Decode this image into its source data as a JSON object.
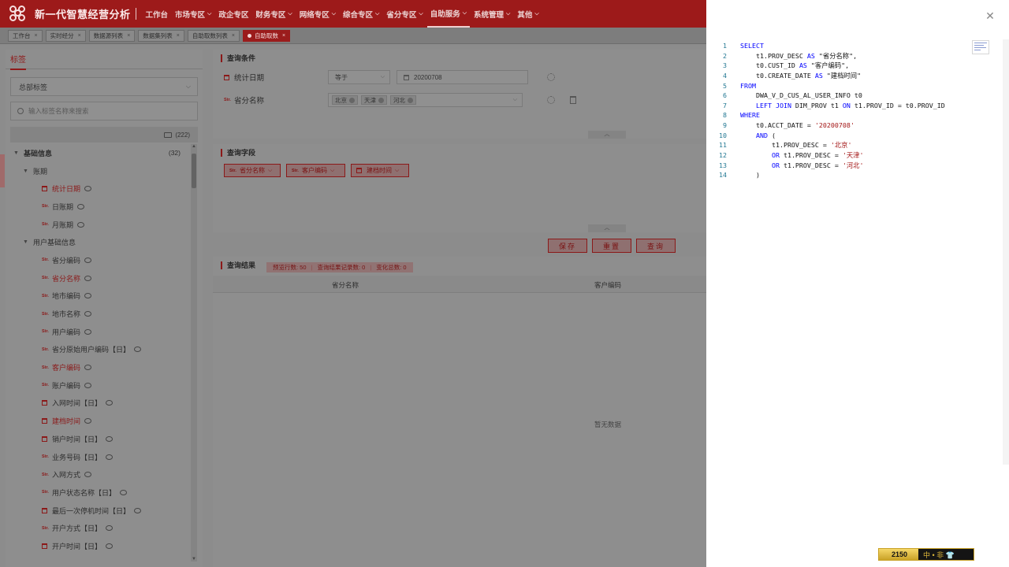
{
  "header": {
    "brand": "新一代智慧经营分析",
    "nav": [
      {
        "label": "工作台",
        "caret": false
      },
      {
        "label": "市场专区",
        "caret": true
      },
      {
        "label": "政企专区",
        "caret": false
      },
      {
        "label": "财务专区",
        "caret": true
      },
      {
        "label": "网络专区",
        "caret": true
      },
      {
        "label": "综合专区",
        "caret": true
      },
      {
        "label": "省分专区",
        "caret": true
      },
      {
        "label": "自助服务",
        "caret": true,
        "active": true
      },
      {
        "label": "系统管理",
        "caret": true
      },
      {
        "label": "其他",
        "caret": true
      }
    ]
  },
  "tabs": [
    {
      "label": "工作台"
    },
    {
      "label": "实时经分"
    },
    {
      "label": "数据源列表"
    },
    {
      "label": "数据集列表"
    },
    {
      "label": "自助取数列表"
    },
    {
      "label": "自助取数",
      "active": true
    }
  ],
  "left_panel": {
    "header": "标签",
    "select_value": "总部标签",
    "search_placeholder": "输入标签名称来搜索",
    "total_count": "(222)",
    "tree": [
      {
        "level": 1,
        "label": "基础信息",
        "count": "(32)"
      },
      {
        "level": 2,
        "label": "账期"
      },
      {
        "level": 3,
        "type": "cal",
        "label": "统计日期",
        "red": true
      },
      {
        "level": 3,
        "type": "Str.",
        "label": "日账期"
      },
      {
        "level": 3,
        "type": "Str.",
        "label": "月账期"
      },
      {
        "level": 2,
        "label": "用户基础信息"
      },
      {
        "level": 3,
        "type": "Str.",
        "label": "省分编码"
      },
      {
        "level": 3,
        "type": "Str.",
        "label": "省分名称",
        "red": true
      },
      {
        "level": 3,
        "type": "Str.",
        "label": "地市编码"
      },
      {
        "level": 3,
        "type": "Str.",
        "label": "地市名称"
      },
      {
        "level": 3,
        "type": "Str.",
        "label": "用户编码"
      },
      {
        "level": 3,
        "type": "Str.",
        "label": "省分原始用户编码【日】"
      },
      {
        "level": 3,
        "type": "Str.",
        "label": "客户编码",
        "red": true
      },
      {
        "level": 3,
        "type": "Str.",
        "label": "账户编码"
      },
      {
        "level": 3,
        "type": "cal",
        "label": "入网时间【日】"
      },
      {
        "level": 3,
        "type": "cal",
        "label": "建档时间",
        "red": true
      },
      {
        "level": 3,
        "type": "cal",
        "label": "销户时间【日】"
      },
      {
        "level": 3,
        "type": "Str.",
        "label": "业务号码【日】"
      },
      {
        "level": 3,
        "type": "Str.",
        "label": "入网方式"
      },
      {
        "level": 3,
        "type": "Str.",
        "label": "用户状态名称【日】"
      },
      {
        "level": 3,
        "type": "cal",
        "label": "最后一次停机时间【日】"
      },
      {
        "level": 3,
        "type": "Str.",
        "label": "开户方式【日】"
      },
      {
        "level": 3,
        "type": "cal",
        "label": "开户时间【日】"
      }
    ]
  },
  "query": {
    "conditions_title": "查询条件",
    "conditions": [
      {
        "label": "统计日期",
        "op": "等于",
        "value": "20200708"
      },
      {
        "label": "省分名称",
        "chips": [
          "北京",
          "天津",
          "河北"
        ]
      }
    ],
    "fields_title": "查询字段",
    "fields": [
      {
        "type": "Str.",
        "label": "省分名称"
      },
      {
        "type": "Str.",
        "label": "客户编码"
      },
      {
        "type": "cal",
        "label": "建档时间"
      }
    ],
    "buttons": {
      "save": "保存",
      "reset": "重置",
      "query": "查询"
    },
    "results_title": "查询结果",
    "stats": [
      "预览行数: 50",
      "查询结果记录数: 0",
      "变化总数: 0"
    ],
    "columns": [
      "省分名称",
      "客户编码"
    ],
    "empty_text": "暂无数据"
  },
  "code": {
    "lines": [
      [
        [
          "kw",
          "SELECT"
        ]
      ],
      [
        [
          "id",
          "    t1.PROV_DESC "
        ],
        [
          "kw",
          "AS"
        ],
        [
          "id",
          " \"省分名称\","
        ]
      ],
      [
        [
          "id",
          "    t0.CUST_ID "
        ],
        [
          "kw",
          "AS"
        ],
        [
          "id",
          " \"客户编码\","
        ]
      ],
      [
        [
          "id",
          "    t0.CREATE_DATE "
        ],
        [
          "kw",
          "AS"
        ],
        [
          "id",
          " \"建档时间\""
        ]
      ],
      [
        [
          "kw",
          "FROM"
        ]
      ],
      [
        [
          "id",
          "    DWA_V_D_CUS_AL_USER_INFO t0"
        ]
      ],
      [
        [
          "kw",
          "    LEFT JOIN"
        ],
        [
          "id",
          " DIM_PROV t1 "
        ],
        [
          "kw",
          "ON"
        ],
        [
          "id",
          " t1.PROV_ID = t0.PROV_ID"
        ]
      ],
      [
        [
          "kw",
          "WHERE"
        ]
      ],
      [
        [
          "id",
          "    t0.ACCT_DATE = "
        ],
        [
          "str",
          "'20200708'"
        ]
      ],
      [
        [
          "kw",
          "    AND"
        ],
        [
          "id",
          " ("
        ]
      ],
      [
        [
          "id",
          "        t1.PROV_DESC = "
        ],
        [
          "str",
          "'北京'"
        ]
      ],
      [
        [
          "kw",
          "        OR"
        ],
        [
          "id",
          " t1.PROV_DESC = "
        ],
        [
          "str",
          "'天津'"
        ]
      ],
      [
        [
          "kw",
          "        OR"
        ],
        [
          "id",
          " t1.PROV_DESC = "
        ],
        [
          "str",
          "'河北'"
        ]
      ],
      [
        [
          "id",
          "    )"
        ]
      ]
    ]
  },
  "widget": {
    "value": "2150",
    "symbols": "中 • 非 👕"
  },
  "colors": {
    "brand_red": "#9d1a1a",
    "keyword": "#0000ff",
    "string": "#a31515",
    "line_number": "#237893"
  }
}
